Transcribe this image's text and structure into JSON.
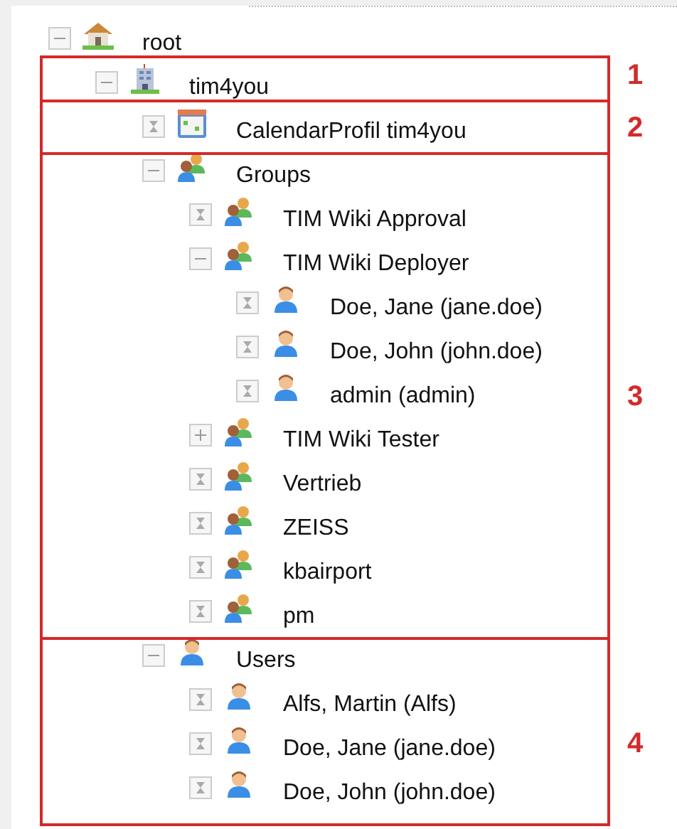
{
  "tree": [
    {
      "label": "root",
      "kind": "home",
      "expanded": true,
      "children": [
        {
          "label": "tim4you",
          "kind": "building",
          "expanded": true,
          "children": [
            {
              "label": "CalendarProfil tim4you",
              "kind": "calendar"
            },
            {
              "label": "Groups",
              "kind": "group",
              "expanded": true,
              "children": [
                {
                  "label": "TIM Wiki Approval",
                  "kind": "group"
                },
                {
                  "label": "TIM Wiki Deployer",
                  "kind": "group",
                  "expanded": true,
                  "children": [
                    {
                      "label": "Doe, Jane (jane.doe)",
                      "kind": "user"
                    },
                    {
                      "label": "Doe, John (john.doe)",
                      "kind": "user"
                    },
                    {
                      "label": "admin (admin)",
                      "kind": "user"
                    }
                  ]
                },
                {
                  "label": "TIM Wiki Tester",
                  "kind": "group",
                  "expanded": false
                },
                {
                  "label": "Vertrieb",
                  "kind": "group"
                },
                {
                  "label": "ZEISS",
                  "kind": "group"
                },
                {
                  "label": "kbairport",
                  "kind": "group"
                },
                {
                  "label": "pm",
                  "kind": "group"
                }
              ]
            },
            {
              "label": "Users",
              "kind": "user",
              "expanded": true,
              "children": [
                {
                  "label": "Alfs, Martin (Alfs)",
                  "kind": "user"
                },
                {
                  "label": "Doe, Jane (jane.doe)",
                  "kind": "user"
                },
                {
                  "label": "Doe, John (john.doe)",
                  "kind": "user"
                }
              ]
            }
          ]
        }
      ]
    }
  ],
  "annotations": [
    {
      "label": "1"
    },
    {
      "label": "2"
    },
    {
      "label": "3"
    },
    {
      "label": "4"
    }
  ]
}
